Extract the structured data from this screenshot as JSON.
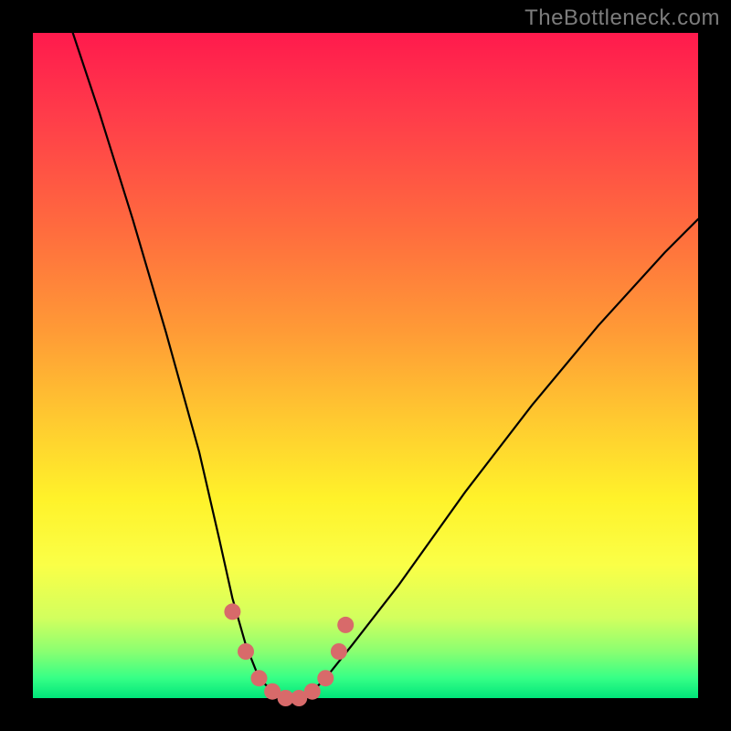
{
  "watermark": "TheBottleneck.com",
  "chart_data": {
    "type": "line",
    "title": "",
    "xlabel": "",
    "ylabel": "",
    "xlim": [
      0,
      100
    ],
    "ylim": [
      0,
      100
    ],
    "series": [
      {
        "name": "bottleneck-curve",
        "x": [
          6,
          10,
          15,
          20,
          25,
          28,
          30,
          32,
          34,
          36,
          38,
          40,
          42,
          44,
          48,
          55,
          65,
          75,
          85,
          95,
          100
        ],
        "values": [
          100,
          88,
          72,
          55,
          37,
          24,
          15,
          8,
          3,
          1,
          0,
          0,
          1,
          3,
          8,
          17,
          31,
          44,
          56,
          67,
          72
        ]
      },
      {
        "name": "highlight-dots",
        "x": [
          30,
          32,
          34,
          36,
          38,
          40,
          42,
          44,
          46,
          47
        ],
        "values": [
          13,
          7,
          3,
          1,
          0,
          0,
          1,
          3,
          7,
          11
        ]
      }
    ],
    "colors": {
      "curve": "#000000",
      "dots": "#d86a6a"
    }
  }
}
